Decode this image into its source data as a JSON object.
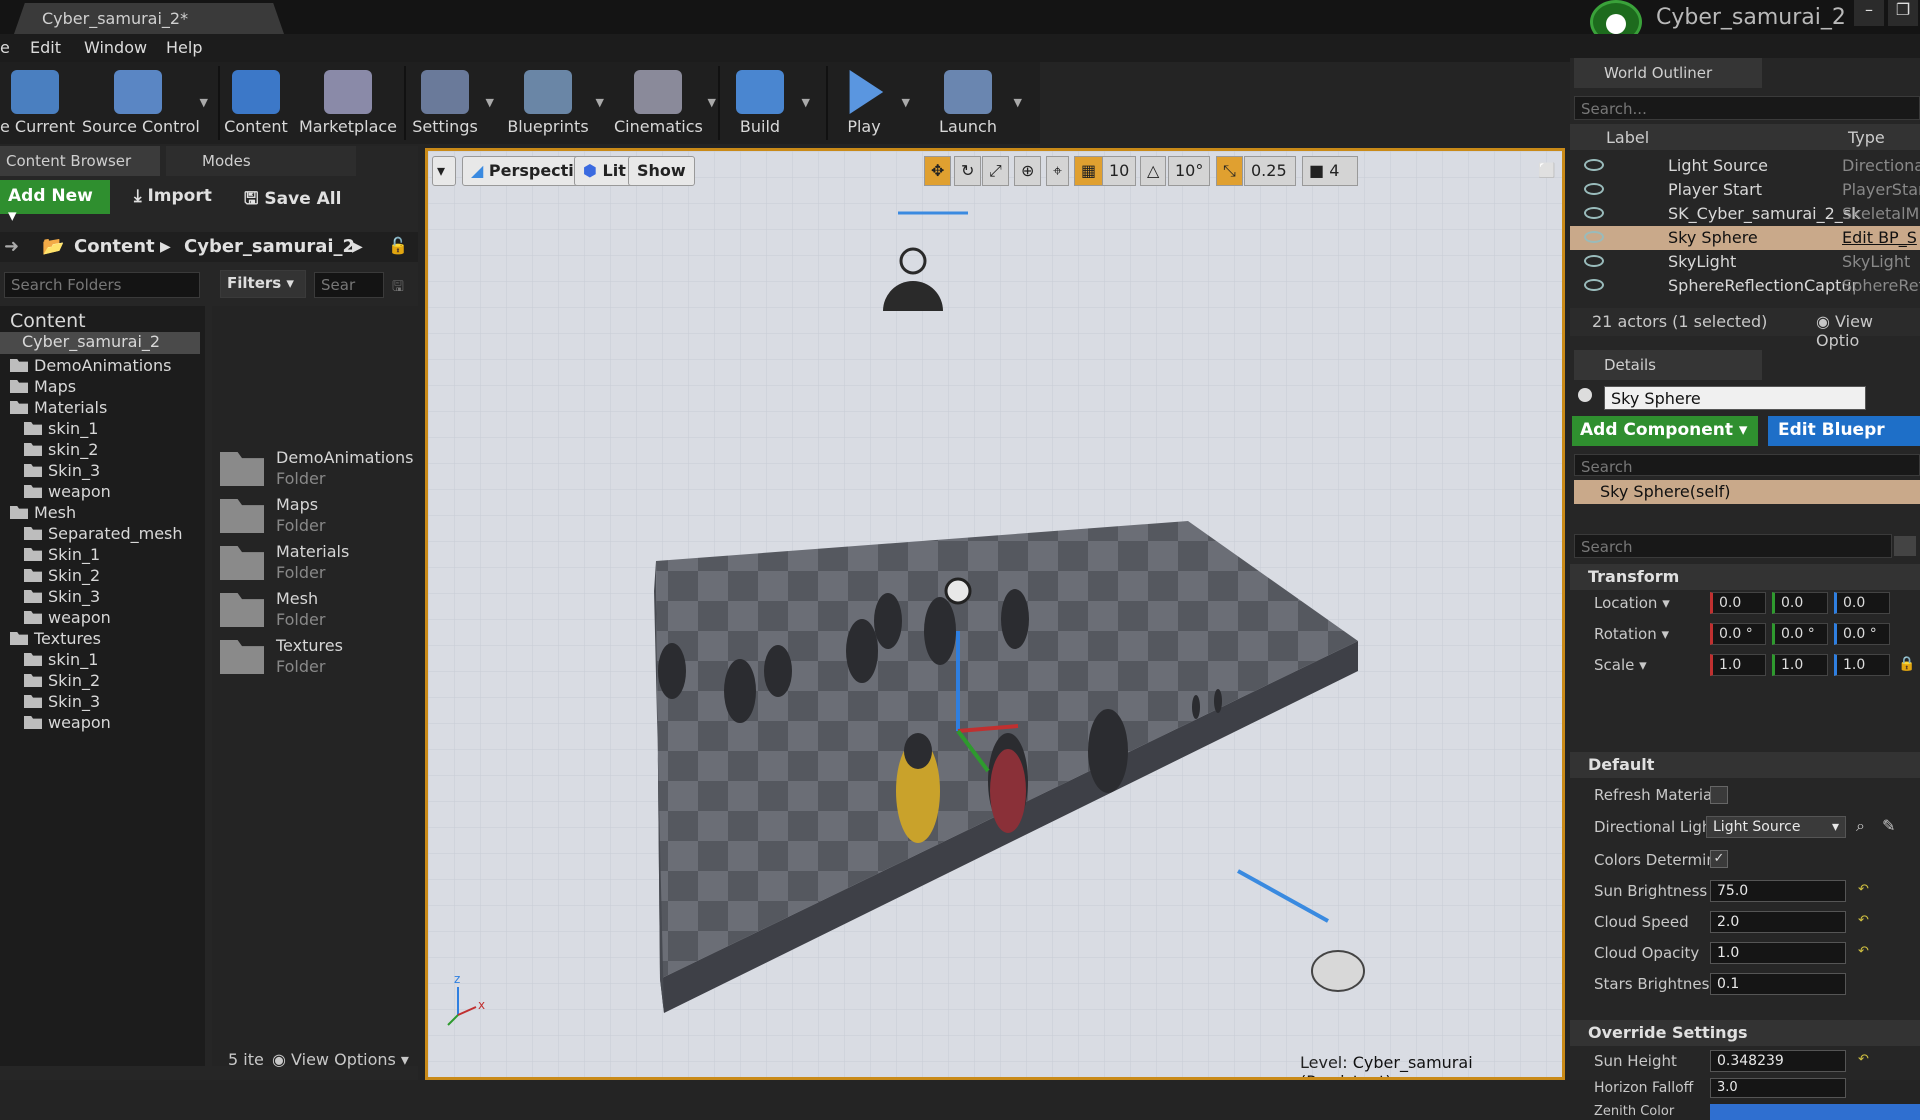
{
  "titlebar": {
    "tab": "Cyber_samurai_2*",
    "project": "Cyber_samurai_2",
    "min": "–",
    "max": "❐"
  },
  "menu": [
    "e",
    "Edit",
    "Window",
    "Help"
  ],
  "toolbar": [
    {
      "label": "e Current",
      "icon": "save-icon",
      "color": "#4a7fc0"
    },
    {
      "label": "Source Control",
      "icon": "source-control-icon",
      "color": "#5a86c4"
    },
    {
      "label": "Content",
      "icon": "content-icon",
      "color": "#3c78c8"
    },
    {
      "label": "Marketplace",
      "icon": "marketplace-icon",
      "color": "#8a8aa8"
    },
    {
      "label": "Settings",
      "icon": "settings-icon",
      "color": "#6a7a9a"
    },
    {
      "label": "Blueprints",
      "icon": "blueprints-icon",
      "color": "#6a86a6"
    },
    {
      "label": "Cinematics",
      "icon": "cinematics-icon",
      "color": "#8a8a9a"
    },
    {
      "label": "Build",
      "icon": "build-icon",
      "color": "#4a86d0"
    },
    {
      "label": "Play",
      "icon": "play-icon",
      "color": "#5a96e0"
    },
    {
      "label": "Launch",
      "icon": "launch-icon",
      "color": "#6a86b0"
    }
  ],
  "content_browser": {
    "tab": "Content Browser",
    "modes_tab": "Modes",
    "add_new": "Add New ▾",
    "import": "Import",
    "save_all": "Save All",
    "crumb_root": "Content",
    "crumb_child": "Cyber_samurai_2",
    "search_folders": "Search Folders",
    "filters": "Filters ▾",
    "search_assets": "Sear",
    "tree": [
      {
        "label": "Content",
        "depth": 0
      },
      {
        "label": "Cyber_samurai_2",
        "depth": 0
      },
      {
        "label": "DemoAnimations",
        "depth": 1
      },
      {
        "label": "Maps",
        "depth": 1
      },
      {
        "label": "Materials",
        "depth": 1
      },
      {
        "label": "skin_1",
        "depth": 2
      },
      {
        "label": "skin_2",
        "depth": 2
      },
      {
        "label": "Skin_3",
        "depth": 2
      },
      {
        "label": "weapon",
        "depth": 2
      },
      {
        "label": "Mesh",
        "depth": 1
      },
      {
        "label": "Separated_mesh",
        "depth": 2
      },
      {
        "label": "Skin_1",
        "depth": 2
      },
      {
        "label": "Skin_2",
        "depth": 2
      },
      {
        "label": "Skin_3",
        "depth": 2
      },
      {
        "label": "weapon",
        "depth": 2
      },
      {
        "label": "Textures",
        "depth": 1
      },
      {
        "label": "skin_1",
        "depth": 2
      },
      {
        "label": "Skin_2",
        "depth": 2
      },
      {
        "label": "Skin_3",
        "depth": 2
      },
      {
        "label": "weapon",
        "depth": 2
      }
    ],
    "assets": [
      {
        "name": "DemoAnimations",
        "type": "Folder"
      },
      {
        "name": "Maps",
        "type": "Folder"
      },
      {
        "name": "Materials",
        "type": "Folder"
      },
      {
        "name": "Mesh",
        "type": "Folder"
      },
      {
        "name": "Textures",
        "type": "Folder"
      }
    ],
    "item_count": "5 ite",
    "view_options": "View Options ▾"
  },
  "viewport": {
    "perspective": "Perspective",
    "lit": "Lit",
    "show": "Show",
    "grid_snap": "10",
    "rot_snap": "10°",
    "scale_snap": "0.25",
    "cam_speed": "4",
    "level_label": "Level:",
    "level_name": "Cyber_samurai (Persistent)"
  },
  "outliner": {
    "tab": "World Outliner",
    "search": "Search...",
    "col_label": "Label",
    "col_type": "Type",
    "rows": [
      {
        "label": "Light Source",
        "type": "Directional"
      },
      {
        "label": "Player Start",
        "type": "PlayerStar"
      },
      {
        "label": "SK_Cyber_samurai_2_sk",
        "type": "SkeletalMe"
      },
      {
        "label": "Sky Sphere",
        "type": "Edit BP_S"
      },
      {
        "label": "SkyLight",
        "type": "SkyLight"
      },
      {
        "label": "SphereReflectionCaptur",
        "type": "SphereRefl"
      }
    ],
    "selected_index": 3,
    "status": "21 actors (1 selected)",
    "view_options": "View Optio"
  },
  "details": {
    "tab": "Details",
    "actor_name": "Sky Sphere",
    "add_component": "Add Component ▾",
    "edit_blueprint": "Edit Bluepr",
    "search1": "Search",
    "component": "Sky Sphere(self)",
    "search2": "Search",
    "transform": "Transform",
    "location_label": "Location ▾",
    "rotation_label": "Rotation ▾",
    "scale_label": "Scale ▾",
    "location": [
      "0.0",
      "0.0",
      "0.0"
    ],
    "rotation": [
      "0.0 °",
      "0.0 °",
      "0.0 °"
    ],
    "scale": [
      "1.0",
      "1.0",
      "1.0"
    ],
    "default_section": "Default",
    "refresh_material": "Refresh Materia",
    "directional_light": "Directional Ligh",
    "directional_light_value": "Light Source",
    "colors_determined": "Colors Determin",
    "sun_brightness_label": "Sun Brightness",
    "sun_brightness": "75.0",
    "cloud_speed_label": "Cloud Speed",
    "cloud_speed": "2.0",
    "cloud_opacity_label": "Cloud Opacity",
    "cloud_opacity": "1.0",
    "stars_brightness_label": "Stars Brightnes:",
    "stars_brightness": "0.1",
    "override_section": "Override Settings",
    "sun_height_label": "Sun Height",
    "sun_height": "0.348239",
    "horizon_falloff_label": "Horizon Falloff",
    "horizon_falloff": "3.0",
    "zenith_color_label": "Zenith Color",
    "zenith_color": "#2f6fd0"
  },
  "colors": {
    "accent_green": "#2f8f2f",
    "accent_blue": "#1e6fc8",
    "viewport_border": "#c98a18",
    "selection": "#c9a98a"
  }
}
